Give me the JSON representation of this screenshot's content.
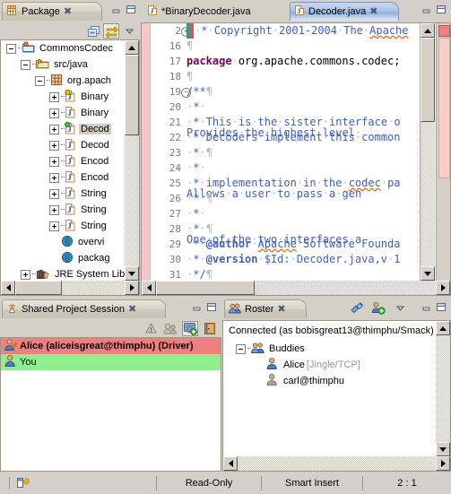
{
  "package_view": {
    "tab_label": "Package",
    "tab_icon": "package-explorer-icon",
    "close_icon": "close-icon",
    "toolbar": [
      {
        "name": "collapse-all-icon",
        "label": "Collapse All",
        "pressed": false
      },
      {
        "name": "link-with-editor-icon",
        "label": "Link with Editor",
        "pressed": true
      },
      {
        "name": "view-menu-chevron-down-icon",
        "label": "View Menu",
        "pressed": false
      }
    ],
    "minimize_label": "Minimize",
    "maximize_label": "Maximize",
    "tree": [
      {
        "label": "CommonsCodec",
        "icon": "java-project-icon",
        "indent": 0,
        "twist": "minus",
        "selected": false
      },
      {
        "label": "src/java",
        "icon": "source-folder-icon",
        "indent": 1,
        "twist": "minus",
        "selected": false
      },
      {
        "label": "org.apach",
        "icon": "package-icon",
        "indent": 2,
        "twist": "minus",
        "selected": false
      },
      {
        "label": "Binary",
        "icon": "java-file-warning-icon",
        "indent": 3,
        "twist": "plus",
        "selected": false
      },
      {
        "label": "Binary",
        "icon": "java-file-icon",
        "indent": 3,
        "twist": "plus",
        "selected": false
      },
      {
        "label": "Decod",
        "icon": "java-file-shared-icon",
        "indent": 3,
        "twist": "plus",
        "selected": true
      },
      {
        "label": "Decod",
        "icon": "java-file-icon",
        "indent": 3,
        "twist": "plus",
        "selected": false
      },
      {
        "label": "Encod",
        "icon": "java-file-icon",
        "indent": 3,
        "twist": "plus",
        "selected": false
      },
      {
        "label": "Encod",
        "icon": "java-file-icon",
        "indent": 3,
        "twist": "plus",
        "selected": false
      },
      {
        "label": "String",
        "icon": "java-file-icon",
        "indent": 3,
        "twist": "plus",
        "selected": false
      },
      {
        "label": "String",
        "icon": "java-file-icon",
        "indent": 3,
        "twist": "plus",
        "selected": false
      },
      {
        "label": "String",
        "icon": "java-file-icon",
        "indent": 3,
        "twist": "plus",
        "selected": false
      },
      {
        "label": "overvi",
        "icon": "html-file-icon",
        "indent": 3,
        "twist": "none",
        "selected": false
      },
      {
        "label": "packag",
        "icon": "html-file-icon",
        "indent": 3,
        "twist": "none",
        "selected": false
      },
      {
        "label": "JRE System Lib",
        "icon": "jre-library-icon",
        "indent": 1,
        "twist": "plus",
        "selected": false
      }
    ]
  },
  "editor": {
    "tabs": [
      {
        "label": "*BinaryDecoder.java",
        "icon": "java-file-icon",
        "active": false,
        "dirty": true
      },
      {
        "label": "Decoder.java",
        "icon": "java-file-icon",
        "active": true,
        "dirty": false
      }
    ],
    "close_icon": "close-icon",
    "minimize_label": "Minimize",
    "maximize_label": "Maximize",
    "lines": [
      {
        "num": "2",
        "folded": true,
        "marker": "change-marker",
        "text": " * Copyright 2001-2004 The Apache"
      },
      {
        "num": "16",
        "folded": false,
        "text": "¶"
      },
      {
        "num": "17",
        "folded": false,
        "text": "package org.apache.commons.codec;"
      },
      {
        "num": "18",
        "folded": false,
        "text": "¶"
      },
      {
        "num": "19",
        "folded": "collapse",
        "text": "/**¶"
      },
      {
        "num": "20",
        "folded": false,
        "text": " * <p>Provides the highest level "
      },
      {
        "num": "21",
        "folded": false,
        "text": " * This is the sister interface o"
      },
      {
        "num": "22",
        "folded": false,
        "text": " * Decoders implement this common"
      },
      {
        "num": "23",
        "folded": false,
        "text": " * ¶"
      },
      {
        "num": "24",
        "folded": false,
        "text": " * <p>Allows a user to pass a gen"
      },
      {
        "num": "25",
        "folded": false,
        "text": " * implementation in the codec pa"
      },
      {
        "num": "26",
        "folded": false,
        "text": " * ¶"
      },
      {
        "num": "27",
        "folded": false,
        "text": " * <p>One of the two interfaces a"
      },
      {
        "num": "28",
        "folded": false,
        "text": " * ¶"
      },
      {
        "num": "29",
        "folded": false,
        "text": " * @author Apache Software Founda"
      },
      {
        "num": "30",
        "folded": false,
        "text": " * @version $Id: Decoder.java,v 1"
      },
      {
        "num": "31",
        "folded": false,
        "text": " */¶"
      }
    ]
  },
  "session_view": {
    "tab_label": "Shared Project Session",
    "tab_icon": "shared-session-icon",
    "close_icon": "close-icon",
    "toolbar": [
      {
        "name": "inconsistency-warning-icon",
        "label": "Inconsistency Detected",
        "pressed": false
      },
      {
        "name": "follow-mode-icon",
        "label": "Follow Mode",
        "pressed": false
      },
      {
        "name": "share-screen-icon",
        "label": "Share Screen with User",
        "pressed": true
      },
      {
        "name": "leave-session-icon",
        "label": "Leave Session",
        "pressed": false
      }
    ],
    "minimize_label": "Minimize",
    "maximize_label": "Maximize",
    "participants": [
      {
        "label": "Alice (aliceisgreat@thimphu) (Driver)",
        "icon": "user-driver-icon",
        "bg": "#f08080",
        "bold": true
      },
      {
        "label": "You",
        "icon": "user-icon",
        "bg": "#90ee90",
        "bold": false
      }
    ]
  },
  "roster_view": {
    "tab_label": "Roster",
    "tab_icon": "roster-icon",
    "close_icon": "close-icon",
    "toolbar": [
      {
        "name": "connect-icon",
        "label": "Connect",
        "pressed": false
      },
      {
        "name": "add-contact-icon",
        "label": "Add Contact",
        "pressed": false
      },
      {
        "name": "view-menu-chevron-down-icon",
        "label": "View Menu",
        "pressed": false
      }
    ],
    "minimize_label": "Minimize",
    "maximize_label": "Maximize",
    "status_text": "Connected (as bobisgreat13@thimphu/Smack)",
    "tree": [
      {
        "label": "Buddies",
        "icon": "buddies-group-icon",
        "indent": 0,
        "twist": "minus",
        "suffix": ""
      },
      {
        "label": "Alice",
        "icon": "contact-online-icon",
        "indent": 1,
        "twist": "none",
        "suffix": "[Jingle/TCP]"
      },
      {
        "label": "carl@thimphu",
        "icon": "contact-offline-icon",
        "indent": 1,
        "twist": "none",
        "suffix": ""
      }
    ]
  },
  "statusbar": {
    "icon": "editing-indicator-icon",
    "cells": [
      "Read-Only",
      "Smart Insert",
      "2 : 1"
    ]
  },
  "colors": {
    "driver_highlight": "#f08080",
    "you_highlight": "#90ee90",
    "active_tab_blue": "#a9c3e6",
    "chrome": "#d4d0c8",
    "keyword": "#7f0055",
    "comment": "#3f5fbf",
    "comment_tag": "#7f9fbf",
    "change_bar": "#f7c6c6"
  }
}
